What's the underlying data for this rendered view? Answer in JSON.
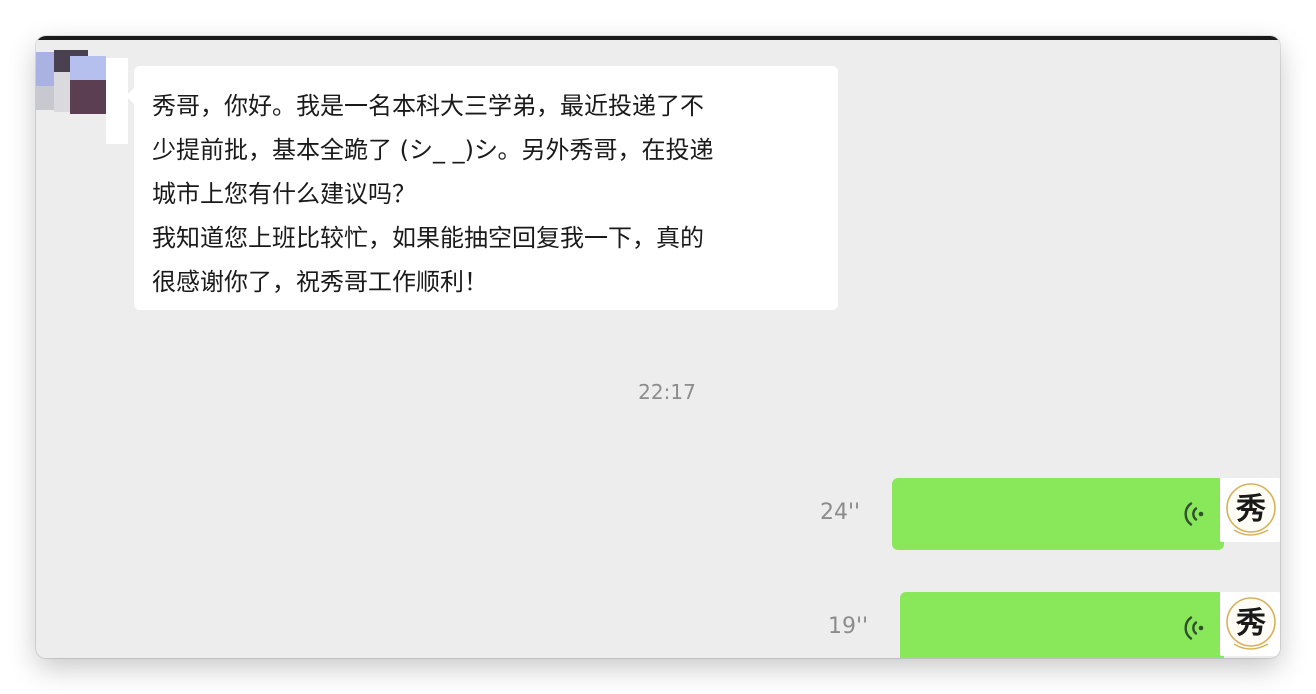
{
  "chat": {
    "incoming_message": {
      "lines": [
        "秀哥，你好。我是一名本科大三学弟，最近投递了不",
        "少提前批，基本全跪了 (シ_ _)シ。另外秀哥，在投递",
        "城市上您有什么建议吗？",
        "我知道您上班比较忙，如果能抽空回复我一下，真的",
        "很感谢你了，祝秀哥工作顺利！"
      ]
    },
    "timestamp": "22:17",
    "voice_messages": [
      {
        "duration": "24''"
      },
      {
        "duration": "19''"
      }
    ]
  },
  "colors": {
    "chat_background": "#ededed",
    "incoming_bubble": "#ffffff",
    "outgoing_bubble": "#89e85a",
    "timestamp_text": "#8c8c8c"
  },
  "icons": {
    "voice": "voice-wave-icon",
    "avatar_text": "秀"
  }
}
